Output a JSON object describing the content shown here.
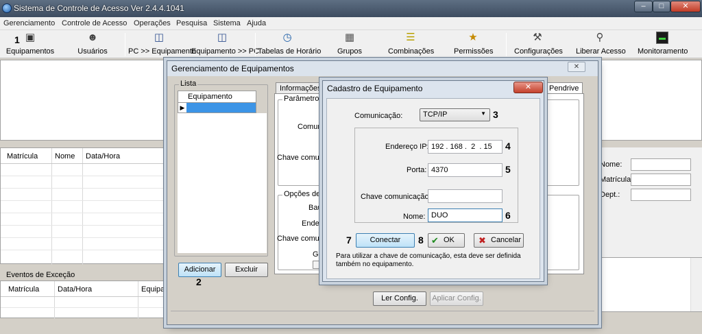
{
  "window": {
    "title": "Sistema de Controle de Acesso  Ver 2.4.4.1041"
  },
  "menu": [
    "Gerenciamento",
    "Controle de Acesso",
    "Operações",
    "Pesquisa",
    "Sistema",
    "Ajuda"
  ],
  "toolbar": [
    {
      "label": "Equipamentos",
      "icon": "devices-icon"
    },
    {
      "label": "Usuários",
      "icon": "users-icon"
    },
    {
      "label": "PC >> Equipamento",
      "icon": "pc-to-device-icon"
    },
    {
      "label": "Equipamento >> PC",
      "icon": "device-to-pc-icon"
    },
    {
      "label": "Tabelas de Horário",
      "icon": "clock-icon"
    },
    {
      "label": "Grupos",
      "icon": "groups-icon"
    },
    {
      "label": "Combinações",
      "icon": "combinations-icon"
    },
    {
      "label": "Permissões",
      "icon": "permissions-icon"
    },
    {
      "label": "Configurações",
      "icon": "settings-icon"
    },
    {
      "label": "Liberar Acesso",
      "icon": "unlock-icon"
    },
    {
      "label": "Monitoramento",
      "icon": "monitor-icon"
    }
  ],
  "records_grid": {
    "columns": [
      "Matrícula",
      "Nome",
      "Data/Hora"
    ]
  },
  "exceptions": {
    "title": "Eventos de Exceção",
    "columns": [
      "Matrícula",
      "Data/Hora",
      "Equipam"
    ]
  },
  "user_info": {
    "name_label": "Nome:",
    "id_label": "Matrícula:",
    "dept_label": "Dept.:"
  },
  "device_mgmt": {
    "title": "Gerenciamento de Equipamentos",
    "list_title": "Lista",
    "list_column": "Equipamento",
    "add_button": "Adicionar",
    "delete_button": "Excluir",
    "tab_info": "Informações",
    "tab_pendrive": "Pendrive",
    "params_group": "Parâmetros d",
    "comm_label": "Comunic",
    "key_label": "Chave comunic",
    "options_group": "Opções de C",
    "baud_label": "Baud",
    "address_label": "Endere",
    "key2_label": "Chave comunic",
    "ga_label": "Ga",
    "read_config": "Ler Config.",
    "apply_config": "Aplicar Config."
  },
  "device_register": {
    "title": "Cadastro de Equipamento",
    "comm_label": "Comunicação:",
    "comm_value": "TCP/IP",
    "ip_label": "Endereço IP:",
    "ip_value": "192 . 168 .  2  . 15",
    "port_label": "Porta:",
    "port_value": "4370",
    "key_label": "Chave comunicação:",
    "key_value": "",
    "name_label": "Nome:",
    "name_value": "DUO",
    "connect_button": "Conectar",
    "ok_button": "OK",
    "cancel_button": "Cancelar",
    "note": "Para utilizar a chave de comunicação, esta deve ser definida também no equipamento."
  },
  "step_numbers": [
    "1",
    "2",
    "3",
    "4",
    "5",
    "6",
    "7",
    "8"
  ]
}
